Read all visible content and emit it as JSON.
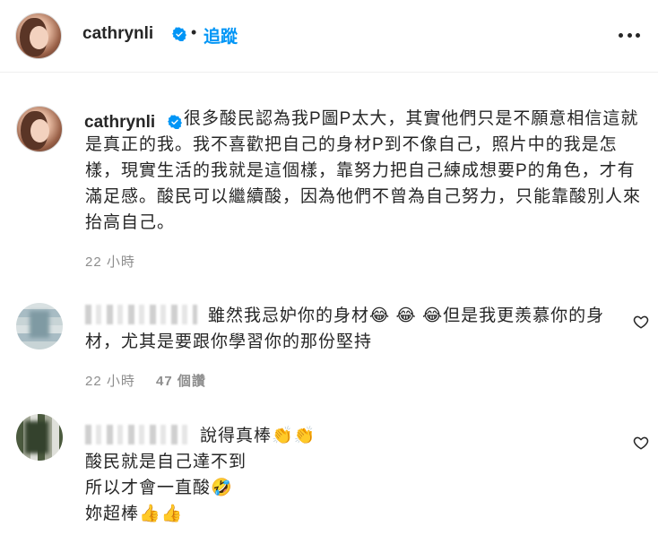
{
  "header": {
    "username": "cathrynli",
    "separator": "•",
    "follow_label": "追蹤"
  },
  "caption": {
    "username": "cathrynli",
    "text": "很多酸民認為我P圖P太大，其實他們只是不願意相信這就是真正的我。我不喜歡把自己的身材P到不像自己，照片中的我是怎樣，現實生活的我就是這個樣，靠努力把自己練成想要P的角色，才有滿足感。酸民可以繼續酸，因為他們不曾為自己努力，只能靠酸別人來抬高自己。",
    "time": "22 小時"
  },
  "comments": [
    {
      "text": "雖然我忌妒你的身材😂 😂 😂但是我更羨慕你的身材，尤其是要跟你學習你的那份堅持",
      "time": "22 小時",
      "likes": "47 個讚"
    },
    {
      "lines": [
        "說得真棒👏👏",
        "酸民就是自己達不到",
        "所以才會一直酸🤣",
        "妳超棒👍👍"
      ]
    }
  ],
  "colors": {
    "accent": "#0095f6",
    "verified_badge": "#0095f6",
    "secondary_text": "#8e8e8e"
  },
  "icons": {
    "verified": "verified-badge-icon",
    "more": "more-options-icon",
    "like": "heart-outline-icon"
  }
}
